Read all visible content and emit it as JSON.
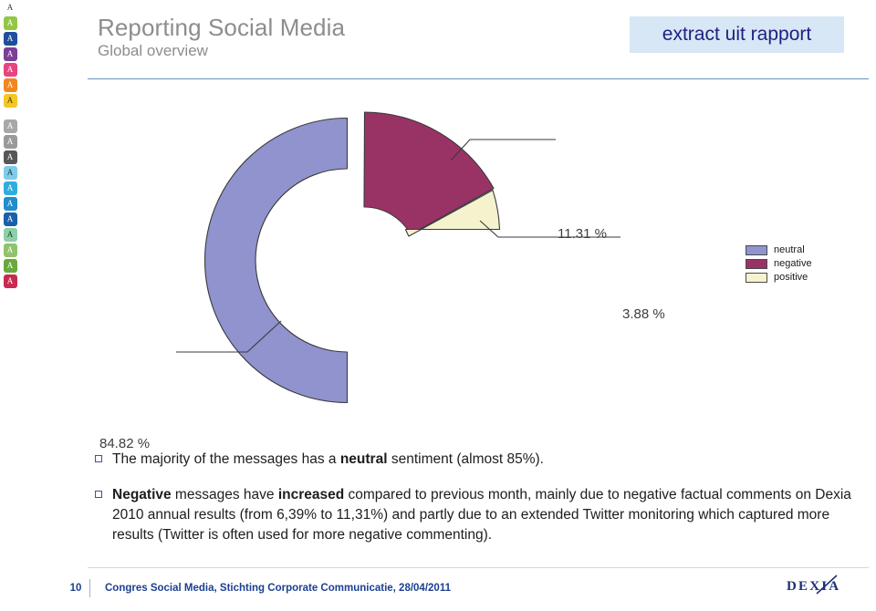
{
  "style_rail": {
    "swatches": [
      {
        "name": "style-default",
        "label": "A",
        "bg": "transparent",
        "fg": "#3a3a3a",
        "plain": true
      },
      {
        "name": "style-green",
        "label": "A",
        "bg": "#92c746",
        "fg": "#ffffff"
      },
      {
        "name": "style-blue",
        "label": "A",
        "bg": "#1f4e9c",
        "fg": "#ffffff"
      },
      {
        "name": "style-purple",
        "label": "A",
        "bg": "#7b3f98",
        "fg": "#ffffff"
      },
      {
        "name": "style-pink",
        "label": "A",
        "bg": "#e8447f",
        "fg": "#ffffff"
      },
      {
        "name": "style-orange",
        "label": "A",
        "bg": "#f2871f",
        "fg": "#ffffff"
      },
      {
        "name": "style-yellow",
        "label": "A",
        "bg": "#f5c724",
        "fg": "#4a3a00"
      },
      {
        "name": "style-gap",
        "spacer": true
      },
      {
        "name": "style-gray-light",
        "label": "A",
        "bg": "#a8a8a8",
        "fg": "#ffffff"
      },
      {
        "name": "style-gray-mid",
        "label": "A",
        "bg": "#9a9a9a",
        "fg": "#ffffff"
      },
      {
        "name": "style-gray-dark",
        "label": "A",
        "bg": "#575757",
        "fg": "#ffffff"
      },
      {
        "name": "style-sky",
        "label": "A",
        "bg": "#7fcbe8",
        "fg": "#10384a"
      },
      {
        "name": "style-cyan",
        "label": "A",
        "bg": "#2eaede",
        "fg": "#ffffff"
      },
      {
        "name": "style-azure",
        "label": "A",
        "bg": "#1f8ecb",
        "fg": "#ffffff"
      },
      {
        "name": "style-navy",
        "label": "A",
        "bg": "#1b5fa8",
        "fg": "#ffffff"
      },
      {
        "name": "style-mint",
        "label": "A",
        "bg": "#8ecfa8",
        "fg": "#10402a"
      },
      {
        "name": "style-lime",
        "label": "A",
        "bg": "#8fc46a",
        "fg": "#ffffff"
      },
      {
        "name": "style-leaf",
        "label": "A",
        "bg": "#6aa83f",
        "fg": "#ffffff"
      },
      {
        "name": "style-crimson",
        "label": "A",
        "bg": "#c82a52",
        "fg": "#ffffff"
      }
    ]
  },
  "header": {
    "title": "Reporting Social Media",
    "subtitle": "Global overview",
    "badge": "extract uit rapport"
  },
  "chart_data": {
    "type": "pie",
    "variant": "exploded-donut",
    "title": "",
    "categories": [
      "neutral",
      "negative",
      "positive"
    ],
    "values": [
      84.82,
      11.31,
      3.88
    ],
    "data_labels": [
      "84.82 %",
      "11.31 %",
      "3.88 %"
    ],
    "colors": [
      "#9193ce",
      "#993366",
      "#f5f2ce"
    ],
    "outline_color": "#3a3a3a",
    "legend": {
      "position": "right",
      "entries": [
        {
          "label": "neutral",
          "color": "#9193ce"
        },
        {
          "label": "negative",
          "color": "#993366"
        },
        {
          "label": "positive",
          "color": "#f5f2ce"
        }
      ]
    },
    "notes": "Donut with hole; negative and positive slices exploded outward from centre; leader lines connect slices to percentage labels."
  },
  "bullets": [
    {
      "id": "bullet-neutral-majority",
      "runs": [
        {
          "text": "The majority of the messages has a ",
          "bold": false
        },
        {
          "text": "neutral",
          "bold": true
        },
        {
          "text": " sentiment (almost 85%).",
          "bold": false
        }
      ]
    },
    {
      "id": "bullet-negative-increase",
      "runs": [
        {
          "text": "Negative",
          "bold": true
        },
        {
          "text": " messages have ",
          "bold": false
        },
        {
          "text": "increased",
          "bold": true
        },
        {
          "text": " compared to previous month, mainly due to negative factual comments on Dexia 2010 annual results (from 6,39% to 11,31%) and partly due to an extended Twitter monitoring which captured more results (Twitter is often used for more negative commenting).",
          "bold": false
        }
      ]
    }
  ],
  "footer": {
    "page_number": "10",
    "text": "Congres Social Media, Stichting Corporate Communicatie, 28/04/2011",
    "logo": "DEXIA"
  }
}
